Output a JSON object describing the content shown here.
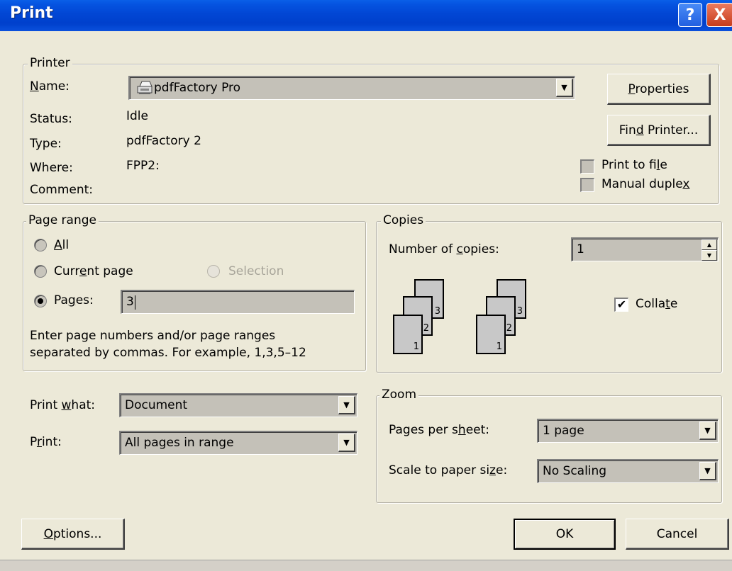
{
  "window": {
    "title": "Print",
    "help_glyph": "?",
    "close_glyph": "X"
  },
  "printer": {
    "group_label": "Printer",
    "name_label": "Name:",
    "name_value": "pdfFactory Pro",
    "status_label": "Status:",
    "status_value": "Idle",
    "type_label": "Type:",
    "type_value": "pdfFactory 2",
    "where_label": "Where:",
    "where_value": "FPP2:",
    "comment_label": "Comment:",
    "properties_button": "Properties",
    "find_printer_button": "Find Printer...",
    "print_to_file": {
      "label": "Print to file",
      "checked": false
    },
    "manual_duplex": {
      "label": "Manual duplex",
      "checked": false
    }
  },
  "page_range": {
    "group_label": "Page range",
    "all_label": "All",
    "current_page_label": "Current page",
    "selection_label": "Selection",
    "pages_label": "Pages:",
    "pages_value": "3",
    "selected": "pages",
    "help_line1": "Enter page numbers and/or page ranges",
    "help_line2": "separated by commas.  For example, 1,3,5–12"
  },
  "copies": {
    "group_label": "Copies",
    "number_label": "Number of copies:",
    "number_value": "1",
    "collate_label": "Collate",
    "collate_checked": true,
    "stack_left": [
      "1",
      "2",
      "3"
    ],
    "stack_right": [
      "1",
      "2",
      "3"
    ]
  },
  "print_what": {
    "label": "Print what:",
    "value": "Document"
  },
  "print": {
    "label": "Print:",
    "value": "All pages in range"
  },
  "zoom": {
    "group_label": "Zoom",
    "pages_per_sheet_label": "Pages per sheet:",
    "pages_per_sheet_value": "1 page",
    "scale_label": "Scale to paper size:",
    "scale_value": "No Scaling"
  },
  "buttons": {
    "options": "Options...",
    "ok": "OK",
    "cancel": "Cancel"
  },
  "icons": {
    "dropdown": "▼",
    "spin_up": "▲",
    "spin_down": "▼",
    "check": "✔"
  },
  "colors": {
    "titlebar": "#0046d5",
    "dialog_bg": "#ece9d8",
    "field_bg": "#c4c1b8"
  }
}
